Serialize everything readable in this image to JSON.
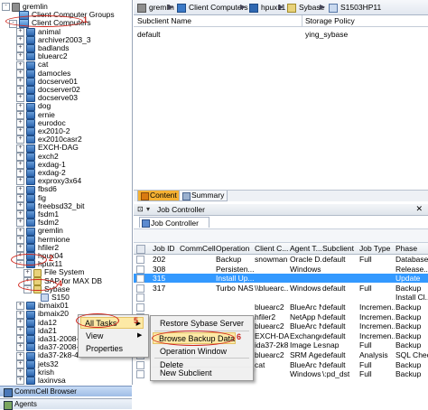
{
  "tree": {
    "root": "gremlin",
    "nodes": [
      {
        "label": "gremlin",
        "icon": "server-icon"
      },
      {
        "label": "Client Computer Groups",
        "icon": "client-group-icon"
      },
      {
        "label": "Client Computers",
        "icon": "client-group-icon"
      },
      {
        "label": "animal",
        "icon": "client-icon"
      },
      {
        "label": "archiver2003_3",
        "icon": "client-icon"
      },
      {
        "label": "badlands",
        "icon": "client-icon"
      },
      {
        "label": "bluearc2",
        "icon": "client-icon"
      },
      {
        "label": "cat",
        "icon": "client-icon"
      },
      {
        "label": "damocles",
        "icon": "client-icon"
      },
      {
        "label": "docserve01",
        "icon": "client-icon"
      },
      {
        "label": "docserver02",
        "icon": "client-icon"
      },
      {
        "label": "docserve03",
        "icon": "client-icon"
      },
      {
        "label": "dog",
        "icon": "client-icon"
      },
      {
        "label": "ernie",
        "icon": "client-icon"
      },
      {
        "label": "eurodoc",
        "icon": "client-icon"
      },
      {
        "label": "ex2010-2",
        "icon": "client-icon"
      },
      {
        "label": "ex2010casr2",
        "icon": "client-icon"
      },
      {
        "label": "EXCH-DAG",
        "icon": "client-icon"
      },
      {
        "label": "exch2",
        "icon": "client-icon"
      },
      {
        "label": "exdag-1",
        "icon": "client-icon"
      },
      {
        "label": "exdag-2",
        "icon": "client-icon"
      },
      {
        "label": "exproxy3x64",
        "icon": "client-icon"
      },
      {
        "label": "fbsd6",
        "icon": "client-icon"
      },
      {
        "label": "fig",
        "icon": "client-icon"
      },
      {
        "label": "freebsd32_bit",
        "icon": "client-icon"
      },
      {
        "label": "fsdm1",
        "icon": "client-icon"
      },
      {
        "label": "fsdm2",
        "icon": "client-icon"
      },
      {
        "label": "gremlin",
        "icon": "client-icon"
      },
      {
        "label": "hermione",
        "icon": "client-icon"
      },
      {
        "label": "hfiler2",
        "icon": "client-icon"
      },
      {
        "label": "hpux04",
        "icon": "client-icon"
      },
      {
        "label": "hpux11",
        "icon": "client-icon"
      },
      {
        "label": "File System",
        "icon": "agent-icon"
      },
      {
        "label": "SAP for MAX DB",
        "icon": "agent-icon"
      },
      {
        "label": "Sybase",
        "icon": "agent-icon"
      },
      {
        "label": "S150",
        "icon": "instance-icon"
      },
      {
        "label": "ibmaix01",
        "icon": "client-icon"
      },
      {
        "label": "ibmaix20",
        "icon": "client-icon"
      },
      {
        "label": "ida12",
        "icon": "client-icon"
      },
      {
        "label": "ida21",
        "icon": "client-icon"
      },
      {
        "label": "ida31-2008-x",
        "icon": "client-icon"
      },
      {
        "label": "ida37-2008-r2ay",
        "icon": "client-icon"
      },
      {
        "label": "ida37-2k8-4ever",
        "icon": "client-icon"
      },
      {
        "label": "jets32",
        "icon": "client-icon"
      },
      {
        "label": "krish",
        "icon": "client-icon"
      },
      {
        "label": "laxinvsa",
        "icon": "client-icon"
      }
    ],
    "bottom_tabs": [
      "CommCell Browser",
      "Agents"
    ]
  },
  "annotations": [
    "1",
    "2",
    "4",
    "5",
    "6"
  ],
  "breadcrumb": [
    "gremlin",
    "Client Computers",
    "hpux11",
    "Sybase",
    "S1503HP11"
  ],
  "subclient_table": {
    "headers": [
      "Subclient Name",
      "Storage Policy"
    ],
    "rows": [
      {
        "name": "default",
        "policy": "ying_sybase"
      }
    ]
  },
  "subclient_tabs": [
    "Content",
    "Summary"
  ],
  "job_controller": {
    "title": "Job Controller",
    "tab_label": "Job Controller",
    "headers": [
      "Job ID",
      "CommCell",
      "Operation",
      "Client C...",
      "Agent T...",
      "Subclient",
      "Job Type",
      "Phase"
    ],
    "rows": [
      [
        "202",
        "",
        "Backup",
        "snowman",
        "Oracle D...",
        "default",
        "Full",
        "Database..."
      ],
      [
        "308",
        "",
        "Persisten...",
        "",
        "Windows...",
        "",
        "",
        "Release..."
      ],
      [
        "315",
        "",
        "Install Up...",
        "",
        "",
        "",
        "",
        "Update"
      ],
      [
        "317",
        "",
        "Turbo NAS",
        "\\\\bluearc...",
        "Windows...",
        "default",
        "Full",
        "Backup"
      ],
      [
        "",
        "",
        "",
        "",
        "",
        "",
        "",
        "Install Cl..."
      ],
      [
        "",
        "",
        "",
        "bluearc2",
        "BlueArc N...",
        "default",
        "Incremen...",
        "Backup"
      ],
      [
        "",
        "",
        "",
        "hfiler2",
        "NetApp NAS",
        "default",
        "Incremen...",
        "Backup"
      ],
      [
        "",
        "",
        "",
        "bluearc2",
        "BlueArc N...",
        "default",
        "Incremen...",
        "Backup"
      ],
      [
        "",
        "",
        "",
        "EXCH-DAG",
        "Exchange...",
        "default",
        "Incremen...",
        "Backup"
      ],
      [
        "",
        "",
        "",
        "ida37-2k8...",
        "Image Le...",
        "snap",
        "Full",
        "Backup"
      ],
      [
        "",
        "",
        "",
        "bluearc2",
        "SRM Agen...",
        "default",
        "Analysis",
        "SQL Check"
      ],
      [
        "",
        "",
        "",
        "cat",
        "BlueArc N...",
        "default",
        "Full",
        "Backup"
      ],
      [
        "",
        "",
        "",
        "",
        "Windows...",
        "\\:pd_dst",
        "Full",
        "Backup"
      ]
    ],
    "selected_row": 2
  },
  "context_menu": {
    "items": [
      "All Tasks",
      "View",
      "Properties"
    ]
  },
  "submenu": {
    "items": [
      "Restore Sybase Server",
      "Browse Backup Data",
      "Operation Window",
      "Delete",
      "New Subclient"
    ]
  },
  "colors": {
    "annotation_red": "#d0281e",
    "selection_blue": "#3399ff",
    "highlight_orange": "#f5b133"
  }
}
